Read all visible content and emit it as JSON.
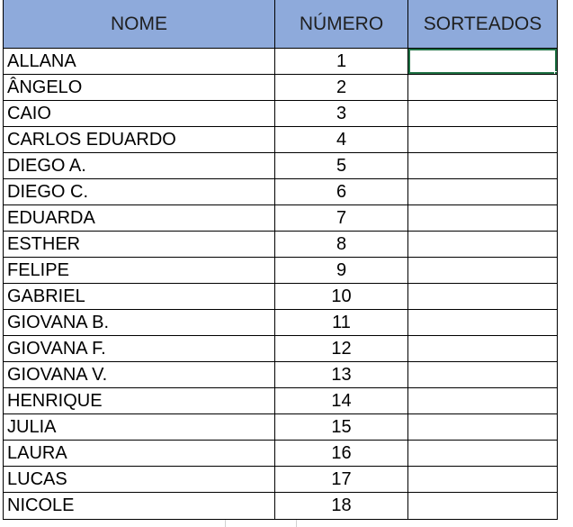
{
  "table": {
    "headers": {
      "name": "NOME",
      "number": "NÚMERO",
      "drawn": "SORTEADOS"
    },
    "rows": [
      {
        "name": "ALLANA",
        "number": "1",
        "drawn": ""
      },
      {
        "name": "ÂNGELO",
        "number": "2",
        "drawn": ""
      },
      {
        "name": "CAIO",
        "number": "3",
        "drawn": ""
      },
      {
        "name": "CARLOS EDUARDO",
        "number": "4",
        "drawn": ""
      },
      {
        "name": "DIEGO A.",
        "number": "5",
        "drawn": ""
      },
      {
        "name": "DIEGO C.",
        "number": "6",
        "drawn": ""
      },
      {
        "name": "EDUARDA",
        "number": "7",
        "drawn": ""
      },
      {
        "name": "ESTHER",
        "number": "8",
        "drawn": ""
      },
      {
        "name": "FELIPE",
        "number": "9",
        "drawn": ""
      },
      {
        "name": "GABRIEL",
        "number": "10",
        "drawn": ""
      },
      {
        "name": "GIOVANA B.",
        "number": "11",
        "drawn": ""
      },
      {
        "name": "GIOVANA F.",
        "number": "12",
        "drawn": ""
      },
      {
        "name": "GIOVANA V.",
        "number": "13",
        "drawn": ""
      },
      {
        "name": "HENRIQUE",
        "number": "14",
        "drawn": ""
      },
      {
        "name": "JULIA",
        "number": "15",
        "drawn": ""
      },
      {
        "name": "LAURA",
        "number": "16",
        "drawn": ""
      },
      {
        "name": "LUCAS",
        "number": "17",
        "drawn": ""
      },
      {
        "name": "NICOLE",
        "number": "18",
        "drawn": ""
      }
    ]
  },
  "colors": {
    "header_fill": "#8eaadb",
    "selection": "#217346",
    "border": "#000000"
  }
}
